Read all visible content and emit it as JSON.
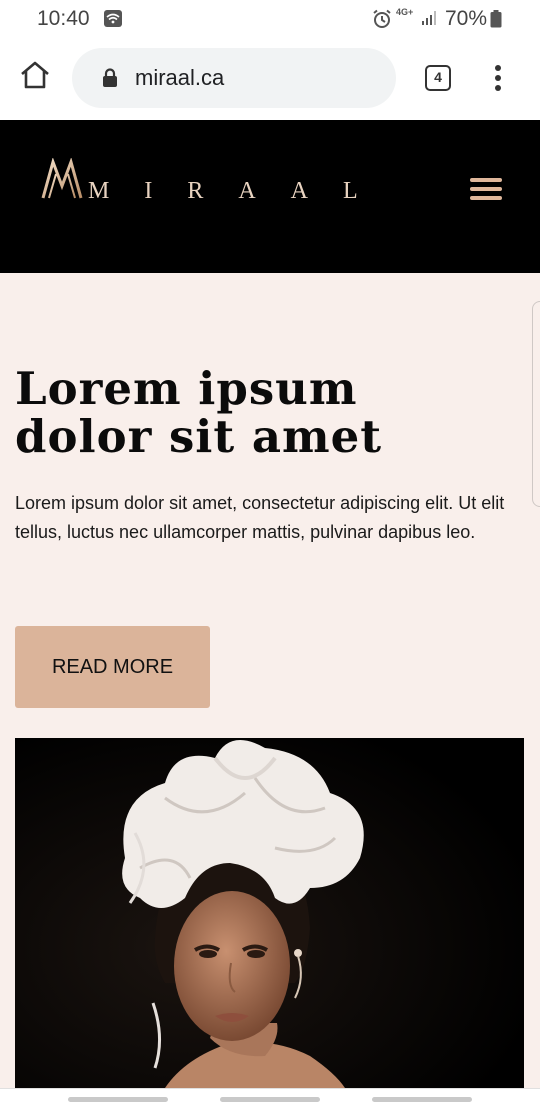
{
  "status_bar": {
    "time": "10:40",
    "network": "4G+",
    "battery": "70%"
  },
  "browser": {
    "url": "miraal.ca",
    "tab_count": "4"
  },
  "site": {
    "brand": "MIRAAL",
    "accent_color": "#dbb49a"
  },
  "hero": {
    "title_line1": "Lorem ipsum",
    "title_line2": "dolor sit amet",
    "body": "Lorem ipsum dolor sit amet, consectetur adipiscing elit. Ut elit tellus, luctus nec ullamcorper mattis, pulvinar dapibus leo.",
    "cta_label": "READ MORE"
  },
  "icons": [
    "wifi-icon",
    "alarm-icon",
    "signal-icon",
    "battery-icon",
    "home-icon",
    "lock-icon",
    "tabs-icon",
    "menu-icon",
    "logo-icon",
    "hamburger-icon"
  ]
}
